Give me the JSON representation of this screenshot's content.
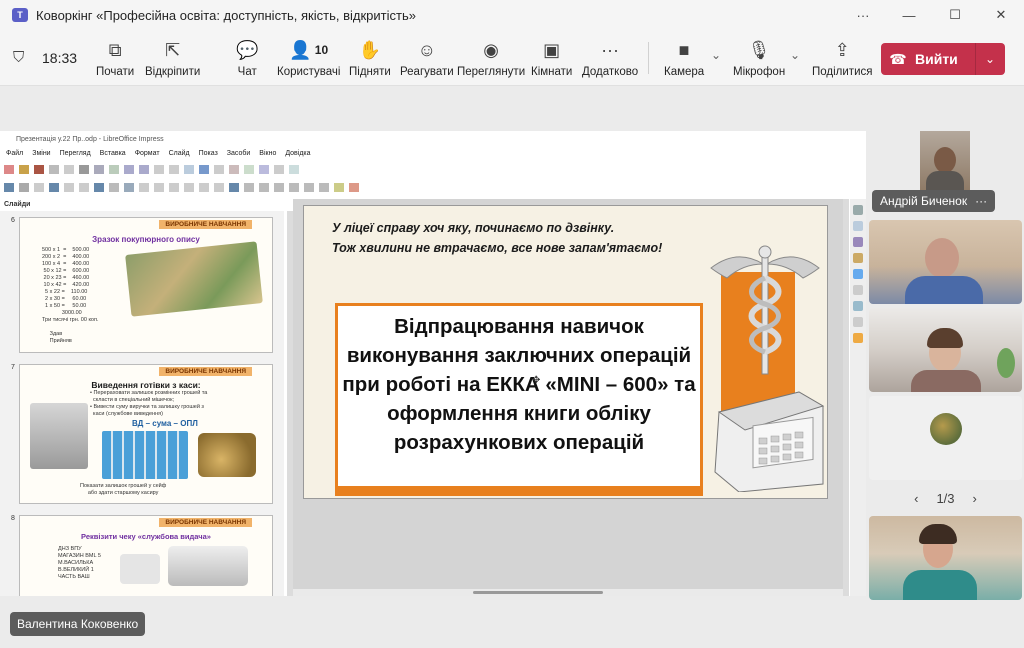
{
  "window": {
    "title": "Коворкінг «Професійна освіта: доступність, якість, відкритість»",
    "controls": [
      "···",
      "—",
      "☐",
      "✕"
    ]
  },
  "toolbar": {
    "time": "18:33",
    "buttons": [
      {
        "label": "Почати",
        "icon": "record-icon"
      },
      {
        "label": "Відкріпити",
        "icon": "popout-icon"
      },
      {
        "label": "Чат",
        "icon": "chat-icon"
      },
      {
        "label": "Користувачі",
        "icon": "people-icon",
        "count": "10"
      },
      {
        "label": "Підняти",
        "icon": "raise-hand-icon"
      },
      {
        "label": "Реагувати",
        "icon": "react-icon"
      },
      {
        "label": "Переглянути",
        "icon": "view-icon"
      },
      {
        "label": "Кімнати",
        "icon": "rooms-icon"
      },
      {
        "label": "Додатково",
        "icon": "more-icon"
      },
      {
        "label": "Камера",
        "icon": "camera-icon"
      },
      {
        "label": "Мікрофон",
        "icon": "mic-icon"
      },
      {
        "label": "Поділитися",
        "icon": "share-icon"
      }
    ],
    "leave_label": "Вийти"
  },
  "presentation": {
    "window_title": "Презентація у.22 Пр..odp - LibreOffice Impress",
    "menu": [
      "Файл",
      "Зміни",
      "Перегляд",
      "Вставка",
      "Формат",
      "Слайд",
      "Показ",
      "Засоби",
      "Вікно",
      "Довідка"
    ],
    "slides_pane_label": "Слайди",
    "thumbnails": [
      {
        "number": "6",
        "tag": "ВИРОБНИЧЕ НАВЧАННЯ",
        "title": "Зразок покупюрного опису",
        "body": "500 x 1  =    500.00\n200 x 2  =    400.00\n100 x 4  =    400.00\n 50 x 12 =    600.00\n 20 x 23 =    460.00\n 10 x 42 =    420.00\n  5 x 22 =    110.00\n  2 x 30 =     60.00\n  1 x 50 =     50.00\n             3000.00\nТри тисячі грн. 00 коп.\n\n     Здав\n     Прийняв"
      },
      {
        "number": "7",
        "tag": "ВИРОБНИЧЕ НАВЧАННЯ",
        "title": "Виведення готівки з каси:",
        "subtitle": "ВД – сума – ОПЛ",
        "body": "• Перераховати залишок розмінних грошей та\n  скласти в спеціальний мішечок;\n• Вивести суму виручки та залишку грошей з\n  каси (службове виведення)",
        "footer": "Показати залишок грошей у сейф\nабо здати старшому касиру"
      },
      {
        "number": "8",
        "tag": "ВИРОБНИЧЕ НАВЧАННЯ",
        "title": "Реквізити чеку «службова видача»",
        "body": "ДНЗ ВПУ\nМАГАЗИН ВМL 5\nМ.ВАСИЛЬКА\nВ.ВЕЛИКИЙ 1\nЧАСТЬ ВАШ\n"
      }
    ],
    "slide": {
      "motto_line1": "У ліцеї справу хоч яку, починаємо по дзвінку.",
      "motto_line2": "Тож хвилини не втрачаємо, все нове запам'ятаємо!",
      "title_lines": [
        "Відпрацювання навичок",
        "виконування заключних операцій",
        "при роботі на ЕККА «MINI – 600» та",
        "оформлення книги обліку",
        "розрахункових операцій"
      ]
    }
  },
  "participants": {
    "presenter_name": "Валентина Коковенко",
    "speaker_name": "Андрій Биченок",
    "speaker_menu": "···",
    "page_indicator": "1/3",
    "prev": "‹",
    "next": "›"
  },
  "colors": {
    "accent_orange": "#e8801e",
    "leave_red": "#c4314b",
    "tag_bg": "#5c5c5c"
  }
}
